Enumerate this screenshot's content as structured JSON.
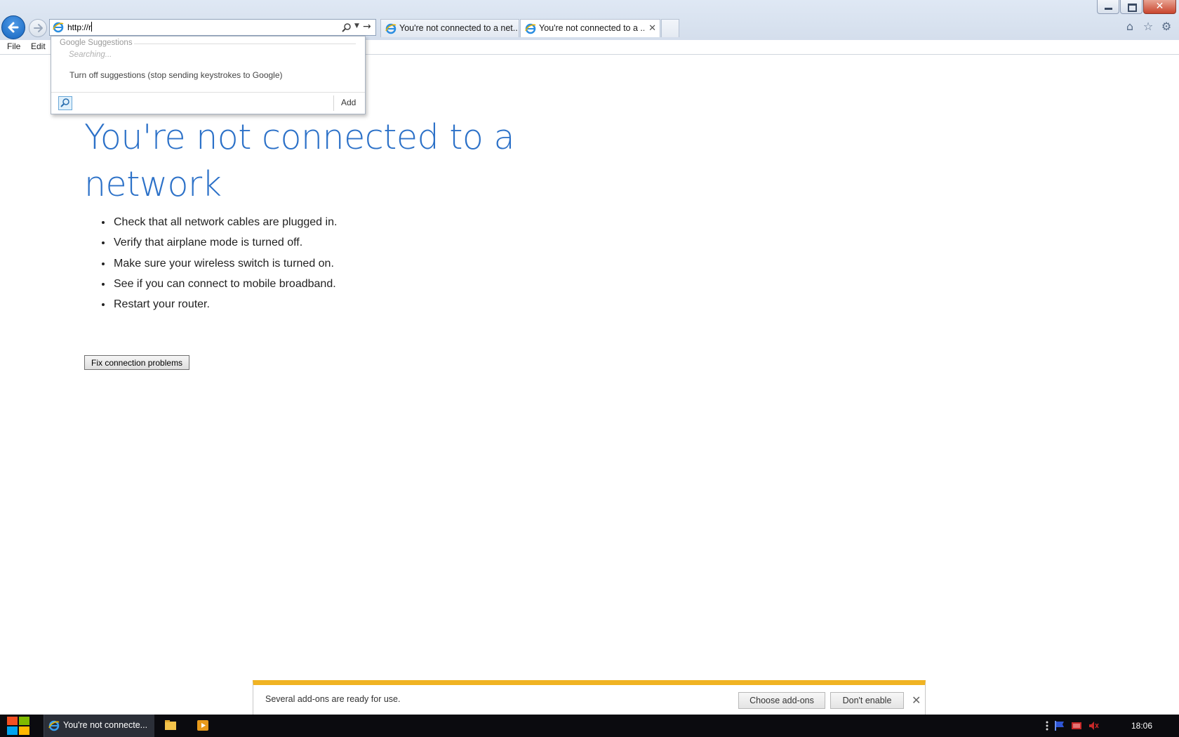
{
  "window": {
    "minimize_icon": "minimize-icon",
    "restore_icon": "restore-icon",
    "close_label": "✕"
  },
  "address_bar": {
    "value": "http://r"
  },
  "tabs": [
    {
      "label": "You're not connected to a net...",
      "active": false
    },
    {
      "label": "You're not connected to a ...",
      "active": true,
      "close": "✕"
    }
  ],
  "menu": {
    "items": [
      "File",
      "Edit"
    ]
  },
  "suggestions": {
    "heading": "Google Suggestions",
    "status": "Searching...",
    "turn_off": "Turn off suggestions (stop sending keystrokes to Google)",
    "add_label": "Add"
  },
  "page": {
    "headline": "You're not connected to a network",
    "tips": [
      "Check that all network cables are plugged in.",
      "Verify that airplane mode is turned off.",
      "Make sure your wireless switch is turned on.",
      "See if you can connect to mobile broadband.",
      "Restart your router."
    ],
    "fix_button": "Fix connection problems",
    "headline_color": "#2c71c8"
  },
  "notification": {
    "message": "Several add-ons are ready for use.",
    "choose_button": "Choose add-ons",
    "dont_enable_button": "Don't enable",
    "close_label": "✕",
    "accent_color": "#f0b323"
  },
  "taskbar": {
    "ie_task_label": "You're not connecte...",
    "clock": "18:06"
  }
}
